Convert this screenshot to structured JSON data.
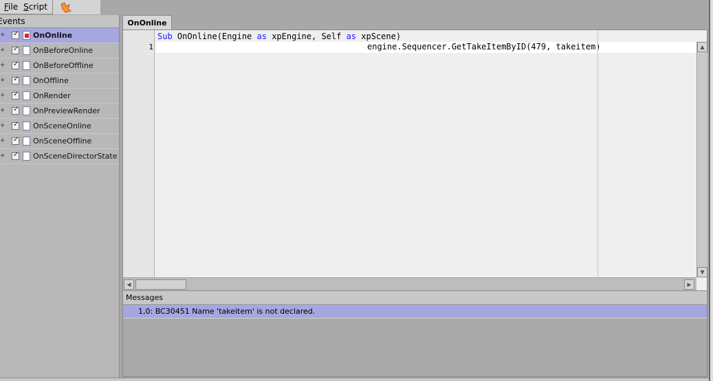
{
  "menu": {
    "items": [
      "File",
      "Script"
    ]
  },
  "events_panel": {
    "header": "Events",
    "items": [
      {
        "label": "OnOnline",
        "selected": true,
        "has_error": true
      },
      {
        "label": "OnBeforeOnline"
      },
      {
        "label": "OnBeforeOffline"
      },
      {
        "label": "OnOffline"
      },
      {
        "label": "OnRender"
      },
      {
        "label": "OnPreviewRender"
      },
      {
        "label": "OnSceneOnline"
      },
      {
        "label": "OnSceneOffline"
      },
      {
        "label": "OnSceneDirectorState"
      }
    ]
  },
  "editor": {
    "tab_label": "OnOnline",
    "line0": {
      "parts": [
        "Sub",
        " OnOnline(Engine ",
        "as",
        " xpEngine, Self ",
        "as",
        " xpScene)"
      ]
    },
    "line1_number": "1",
    "line1_code": "engine.Sequencer.GetTakeItemByID(479, takeitem)"
  },
  "messages": {
    "header": "Messages",
    "items": [
      "1,0: BC30451 Name 'takeitem' is not declared."
    ]
  },
  "colors": {
    "selection": "#a6a6e0",
    "keyword": "#1a1aff",
    "error_marker": "#dd2222"
  }
}
